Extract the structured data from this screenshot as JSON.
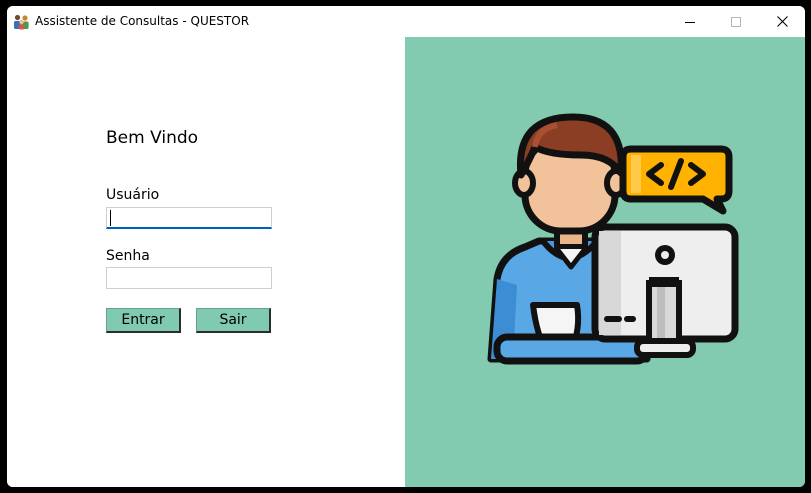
{
  "window": {
    "title": "Assistente de Consultas - QUESTOR",
    "app_icon": "people-group-icon",
    "controls": {
      "minimize_icon": "minimize-icon",
      "maximize_icon": "maximize-icon",
      "close_icon": "close-icon"
    }
  },
  "login": {
    "welcome": "Bem Vindo",
    "username_label": "Usuário",
    "username_value": "",
    "password_label": "Senha",
    "password_value": "",
    "enter_label": "Entrar",
    "exit_label": "Sair"
  },
  "illustration": {
    "icon": "developer-at-computer-icon",
    "code_badge_icon": "code-tag-icon"
  },
  "colors": {
    "panel_green": "#82cab0",
    "button_green": "#7fcab0",
    "focus_blue": "#005fb8",
    "badge_orange": "#ffb200",
    "shirt_blue": "#5aa7e6",
    "hair_brown": "#8b3e24",
    "skin": "#f2c39a"
  }
}
